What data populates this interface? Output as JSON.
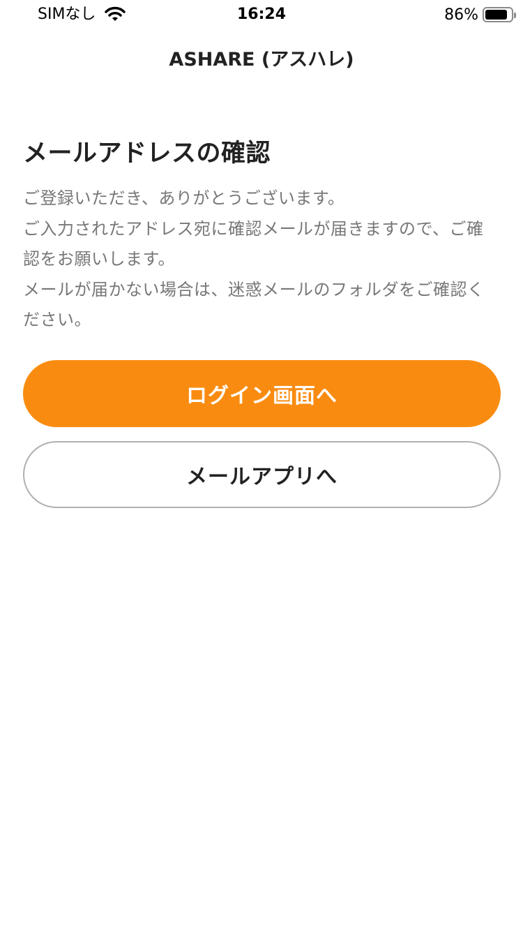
{
  "status_bar": {
    "carrier": "SIMなし",
    "wifi_icon": "wifi-icon",
    "time": "16:24",
    "battery_percent": "86%",
    "battery_level": 0.86,
    "battery_icon": "battery-icon"
  },
  "nav": {
    "title": "ASHARE (アスハレ)"
  },
  "main": {
    "heading": "メールアドレスの確認",
    "body": "ご登録いただき、ありがとうございます。\nご入力されたアドレス宛に確認メールが届きますので、ご確認をお願いします。\nメールが届かない場合は、迷惑メールのフォルダをご確認ください。"
  },
  "buttons": {
    "login": "ログイン画面へ",
    "mail_app": "メールアプリへ"
  },
  "colors": {
    "accent": "#f98c10",
    "body_text": "#777777",
    "heading_text": "#222222",
    "button_border": "#b0b0b0"
  }
}
